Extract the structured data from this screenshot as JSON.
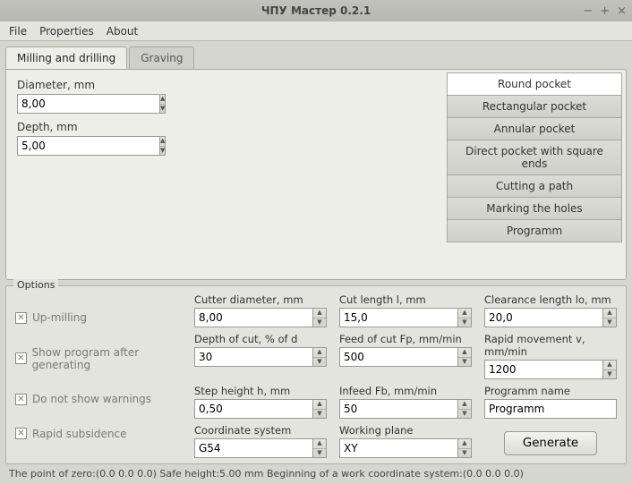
{
  "window": {
    "title": "ЧПУ Мастер 0.2.1"
  },
  "menu": {
    "file": "File",
    "properties": "Properties",
    "about": "About"
  },
  "tabs": {
    "milling": "Milling and drilling",
    "graving": "Graving"
  },
  "pockets": {
    "round": "Round pocket",
    "rect": "Rectangular pocket",
    "annular": "Annular pocket",
    "direct": "Direct pocket with square ends",
    "path": "Cutting a path",
    "marking": "Marking the holes",
    "programm": "Programm"
  },
  "params": {
    "diameter_label": "Diameter, mm",
    "diameter_val": "8,00",
    "depth_label": "Depth, mm",
    "depth_val": "5,00"
  },
  "options_legend": "Options",
  "checks": {
    "upmilling": "Up-milling",
    "showprog": "Show program after generating",
    "nowarn": "Do not show warnings",
    "rapidsub": "Rapid subsidence"
  },
  "opts": {
    "cutter_d_label": "Cutter diameter, mm",
    "cutter_d_val": "8,00",
    "cutlen_label": "Cut length l, mm",
    "cutlen_val": "15,0",
    "clearlen_label": "Clearance length lo, mm",
    "clearlen_val": "20,0",
    "depthcut_label": "Depth of cut, % of d",
    "depthcut_val": "30",
    "feed_label": "Feed of cut Fp, mm/min",
    "feed_val": "500",
    "rapid_label": "Rapid movement v, mm/min",
    "rapid_val": "1200",
    "steph_label": "Step height h, mm",
    "steph_val": "0,50",
    "infeed_label": "Infeed Fb, mm/min",
    "infeed_val": "50",
    "progname_label": "Programm name",
    "progname_val": "Programm",
    "coord_label": "Coordinate system",
    "coord_val": "G54",
    "plane_label": "Working plane",
    "plane_val": "XY",
    "generate": "Generate"
  },
  "status": "The point of zero:(0.0  0.0  0.0)     Safe height:5.00 mm   Beginning of a work coordinate system:(0.0  0.0  0.0)"
}
